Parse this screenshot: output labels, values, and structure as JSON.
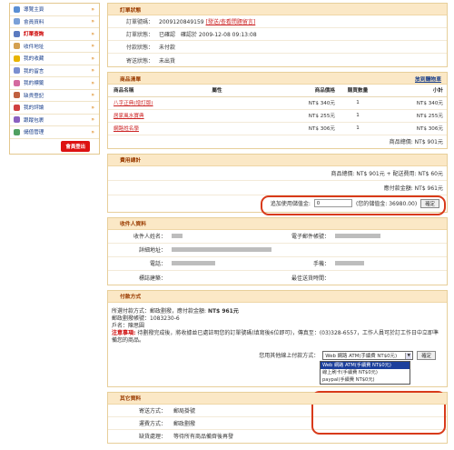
{
  "sidebar": {
    "items": [
      {
        "label": "導覽主頁",
        "icon": "home-icon",
        "color": "#5a8fd4"
      },
      {
        "label": "會員資料",
        "icon": "member-icon",
        "color": "#7aa0d8"
      },
      {
        "label": "訂單查詢",
        "icon": "order-icon",
        "color": "#5a7ac0",
        "active": true
      },
      {
        "label": "收件地址",
        "icon": "address-icon",
        "color": "#d4a050"
      },
      {
        "label": "我的收藏",
        "icon": "star-icon",
        "color": "#e8b400"
      },
      {
        "label": "我的留言",
        "icon": "message-icon",
        "color": "#7a8fd0"
      },
      {
        "label": "我的標籤",
        "icon": "tag-icon",
        "color": "#d46aa0"
      },
      {
        "label": "缺貨登記",
        "icon": "register-icon",
        "color": "#c06040"
      },
      {
        "label": "我的評論",
        "icon": "flag-icon",
        "color": "#d04040"
      },
      {
        "label": "跟蹤包裹",
        "icon": "package-icon",
        "color": "#8a60c0"
      },
      {
        "label": "儲值管理",
        "icon": "wallet-icon",
        "color": "#50a060"
      }
    ],
    "logout_label": "會員登出"
  },
  "order_status": {
    "title": "訂單狀態",
    "rows": [
      {
        "key": "訂單號碼：",
        "value": "2009120849159",
        "link": "[發送/查看問題留言]"
      },
      {
        "key": "訂單狀態：",
        "value": "已確認　確認於 2009-12-08 09:13:08"
      },
      {
        "key": "付款狀態：",
        "value": "未付款"
      },
      {
        "key": "寄送狀態：",
        "value": "未出貨"
      }
    ]
  },
  "item_list": {
    "title": "商品清單",
    "link": "放到購物車",
    "headers": [
      "商品名稱",
      "屬性",
      "商品價格",
      "購買數量",
      "小計"
    ],
    "rows": [
      {
        "name": "八字正典(增訂版)",
        "spec": "",
        "price": "NT$ 340元",
        "qty": "1",
        "sub": "NT$ 340元"
      },
      {
        "name": "居家風水寶典",
        "spec": "",
        "price": "NT$ 255元",
        "qty": "1",
        "sub": "NT$ 255元"
      },
      {
        "name": "網路姓名學",
        "spec": "",
        "price": "NT$ 306元",
        "qty": "1",
        "sub": "NT$ 306元"
      }
    ],
    "total": "商品總價: NT$ 901元"
  },
  "fees": {
    "title": "費用總計",
    "line1": "商品總價: NT$ 901元 + 配送費用: NT$ 60元",
    "line2": "應付款金額: NT$ 961元",
    "credit_label": "追加使用儲值金:",
    "credit_value": "0",
    "credit_balance": "(您的儲值金: 36980.00)",
    "confirm_label": "確定"
  },
  "recipient": {
    "title": "收件人資料",
    "rows": [
      {
        "k1": "收件人姓名：",
        "k2": "電子郵件帳號："
      },
      {
        "k1": "詳細地址：",
        "k2": ""
      },
      {
        "k1": "電話：",
        "k2": "手機："
      },
      {
        "k1": "標誌建築：",
        "k2": "最佳送貨時間："
      }
    ]
  },
  "payment": {
    "title": "付款方式",
    "line1_prefix": "所選付款方式：郵政劃撥，應付款金額: ",
    "line1_amount": "NT$ 961元",
    "line2": "郵政劃撥帳號：1083230-6",
    "line3": "戶名：陳思圓",
    "notice_label": "注意事項:",
    "notice_text": " 待劃撥完成後，將收據並已處註明您的訂單號碼(填寫後6位即可)，傳真至：(03)328-6557，工作人員可於訂工作日中立即準備您的商品。",
    "change_label": "您用其他線上付款方式：",
    "selected": "Web 網路 ATM(手續費 NT$0元)",
    "options": [
      "Web 網路 ATM(手續費 NT$0元)",
      "線上刷卡(手續費 NT$0元)",
      "paypal(手續費 NT$0元)"
    ],
    "confirm_label": "確定"
  },
  "other": {
    "title": "其它資料",
    "rows": [
      {
        "key": "寄送方式：",
        "value": "郵局掛號"
      },
      {
        "key": "運費方式：",
        "value": "郵政劃撥"
      },
      {
        "key": "缺貨處理：",
        "value": "等待所有商品備齊後再發"
      }
    ]
  }
}
